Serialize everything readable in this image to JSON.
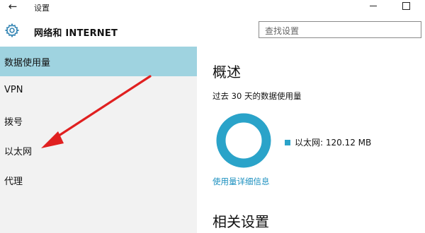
{
  "window": {
    "title": "设置",
    "back_icon": "back-arrow-icon",
    "minimize_icon": "minimize-icon",
    "maximize_icon": "maximize-icon"
  },
  "header": {
    "section_icon": "gear-icon",
    "section_title": "网络和 INTERNET",
    "search": {
      "placeholder": "查找设置",
      "value": ""
    }
  },
  "sidebar": {
    "items": [
      {
        "label": "数据使用量",
        "selected": true
      },
      {
        "label": "VPN",
        "selected": false
      },
      {
        "label": "拨号",
        "selected": false
      },
      {
        "label": "以太网",
        "selected": false
      },
      {
        "label": "代理",
        "selected": false
      }
    ]
  },
  "main": {
    "overview_title": "概述",
    "usage_caption": "过去 30 天的数据使用量",
    "legend_label": "以太网: 120.12 MB",
    "detail_link": "使用量详细信息",
    "related_title": "相关设置"
  },
  "annotation": {
    "arrow_color": "#e02020",
    "points_to": "以太网"
  },
  "colors": {
    "selected_bg": "#9fd3e0",
    "sidebar_bg": "#f2f2f2",
    "accent": "#2aa3c9",
    "link": "#1a8fbf"
  }
}
